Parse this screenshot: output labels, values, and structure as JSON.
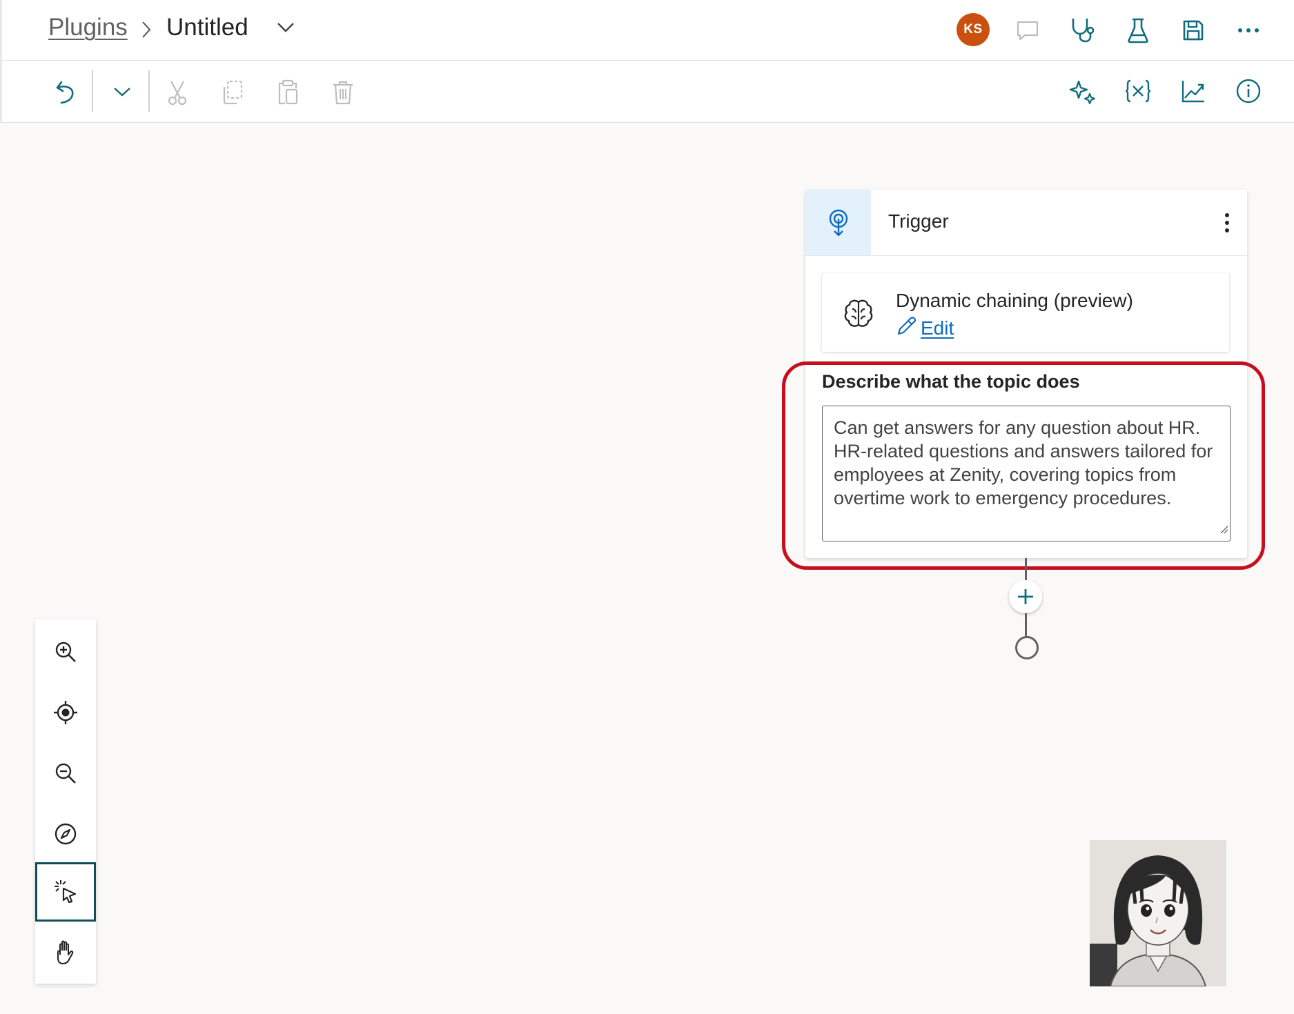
{
  "header": {
    "breadcrumb_parent": "Plugins",
    "breadcrumb_current": "Untitled",
    "avatar_initials": "KS",
    "avatar_color": "#ca5010"
  },
  "toolbar": {
    "left_icons": [
      "undo-icon",
      "chevron-down-icon",
      "cut-icon",
      "copy-icon",
      "paste-icon",
      "delete-icon"
    ],
    "right_icons": [
      "copilot-sparkle-icon",
      "variables-icon",
      "analytics-icon",
      "info-icon"
    ],
    "header_icons": [
      "comment-icon",
      "topic-checker-icon",
      "test-icon",
      "save-icon",
      "more-icon"
    ]
  },
  "trigger_card": {
    "title": "Trigger",
    "chaining_title": "Dynamic chaining (preview)",
    "edit_label": "Edit",
    "description_label": "Describe what the topic does",
    "description_value": "Can get answers for any question about HR. HR-related questions and answers tailored for employees at Zenity, covering topics from overtime work to emergency procedures."
  },
  "zoom_panel": {
    "items": [
      "zoom-in-icon",
      "recenter-icon",
      "zoom-out-icon",
      "minimap-icon",
      "select-icon",
      "pan-hand-icon"
    ],
    "active": "select-icon"
  },
  "colors": {
    "accent": "#0f6cbd",
    "highlight": "#c50f1f",
    "node_teal": "#0f6c7c"
  }
}
